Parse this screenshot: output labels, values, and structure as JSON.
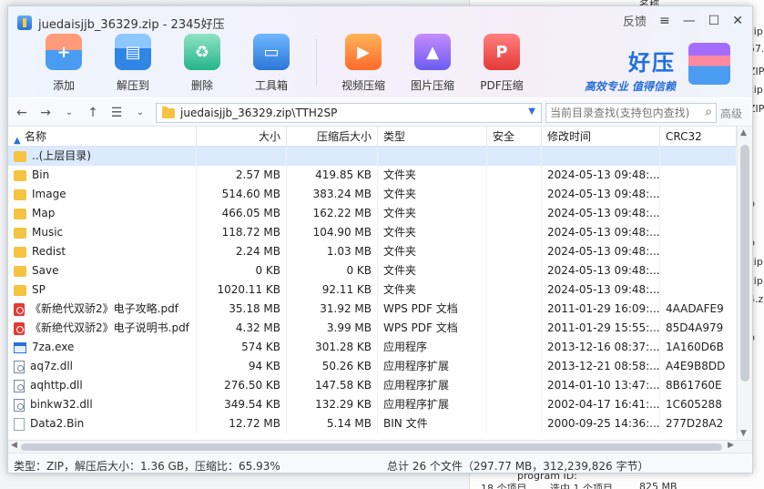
{
  "window": {
    "title": "juedaisjjb_36329.zip - 2345好压"
  },
  "win_controls": {
    "feedback": "反馈",
    "menu": "≡",
    "minimize": "—",
    "maximize": "☐",
    "close": "✕"
  },
  "toolbar": [
    {
      "label": "添加",
      "icon": "add-icon"
    },
    {
      "label": "解压到",
      "icon": "extract-icon"
    },
    {
      "label": "删除",
      "icon": "recycle-icon"
    },
    {
      "label": "工具箱",
      "icon": "toolbox-icon"
    },
    {
      "label": "视频压缩",
      "icon": "video-icon"
    },
    {
      "label": "图片压缩",
      "icon": "image-icon"
    },
    {
      "label": "PDF压缩",
      "icon": "pdf-icon"
    }
  ],
  "brand": {
    "name": "好压",
    "slogan": "高效专业  值得信赖"
  },
  "nav": {
    "path": "juedaisjjb_36329.zip\\TTH2SP",
    "search_placeholder": "当前目录查找(支持包内查找)",
    "advanced": "高级"
  },
  "columns": [
    "名称",
    "大小",
    "压缩后大小",
    "类型",
    "安全",
    "修改时间",
    "CRC32"
  ],
  "rows": [
    {
      "name": "..(上层目录)",
      "size": "",
      "packed": "",
      "type": "",
      "security": "",
      "modified": "",
      "crc": "",
      "kind": "folder",
      "selected": true
    },
    {
      "name": "Bin",
      "size": "2.57 MB",
      "packed": "419.85 KB",
      "type": "文件夹",
      "security": "",
      "modified": "2024-05-13 09:48:...",
      "crc": "",
      "kind": "folder"
    },
    {
      "name": "Image",
      "size": "514.60 MB",
      "packed": "383.24 MB",
      "type": "文件夹",
      "security": "",
      "modified": "2024-05-13 09:48:...",
      "crc": "",
      "kind": "folder"
    },
    {
      "name": "Map",
      "size": "466.05 MB",
      "packed": "162.22 MB",
      "type": "文件夹",
      "security": "",
      "modified": "2024-05-13 09:48:...",
      "crc": "",
      "kind": "folder"
    },
    {
      "name": "Music",
      "size": "118.72 MB",
      "packed": "104.90 MB",
      "type": "文件夹",
      "security": "",
      "modified": "2024-05-13 09:48:...",
      "crc": "",
      "kind": "folder"
    },
    {
      "name": "Redist",
      "size": "2.24 MB",
      "packed": "1.03 MB",
      "type": "文件夹",
      "security": "",
      "modified": "2024-05-13 09:48:...",
      "crc": "",
      "kind": "folder"
    },
    {
      "name": "Save",
      "size": "0 KB",
      "packed": "0 KB",
      "type": "文件夹",
      "security": "",
      "modified": "2024-05-13 09:48:...",
      "crc": "",
      "kind": "folder"
    },
    {
      "name": "SP",
      "size": "1020.11 KB",
      "packed": "92.11 KB",
      "type": "文件夹",
      "security": "",
      "modified": "2024-05-13 09:48:...",
      "crc": "",
      "kind": "folder"
    },
    {
      "name": "《新绝代双骄2》电子攻略.pdf",
      "size": "35.18 MB",
      "packed": "31.92 MB",
      "type": "WPS PDF 文档",
      "security": "",
      "modified": "2011-01-29 16:09:...",
      "crc": "4AADAFE9",
      "kind": "pdf"
    },
    {
      "name": "《新绝代双骄2》电子说明书.pdf",
      "size": "4.32 MB",
      "packed": "3.99 MB",
      "type": "WPS PDF 文档",
      "security": "",
      "modified": "2011-01-29 15:55:...",
      "crc": "85D4A979",
      "kind": "pdf"
    },
    {
      "name": "7za.exe",
      "size": "574 KB",
      "packed": "301.28 KB",
      "type": "应用程序",
      "security": "",
      "modified": "2013-12-16 08:37:...",
      "crc": "1A160D6B",
      "kind": "exe"
    },
    {
      "name": "aq7z.dll",
      "size": "94 KB",
      "packed": "50.26 KB",
      "type": "应用程序扩展",
      "security": "",
      "modified": "2013-12-21 08:58:...",
      "crc": "A4E9B8DD",
      "kind": "dll"
    },
    {
      "name": "aqhttp.dll",
      "size": "276.50 KB",
      "packed": "147.58 KB",
      "type": "应用程序扩展",
      "security": "",
      "modified": "2014-01-10 13:47:...",
      "crc": "8B61760E",
      "kind": "dll"
    },
    {
      "name": "binkw32.dll",
      "size": "349.54 KB",
      "packed": "132.29 KB",
      "type": "应用程序扩展",
      "security": "",
      "modified": "2002-04-17 16:41:...",
      "crc": "1C605288",
      "kind": "dll"
    },
    {
      "name": "Data2.Bin",
      "size": "12.72 MB",
      "packed": "5.14 MB",
      "type": "BIN 文件",
      "security": "",
      "modified": "2000-09-25 14:36:...",
      "crc": "277D28A2",
      "kind": "bin"
    }
  ],
  "status": {
    "left": "类型：ZIP，解压后大小：1.36 GB，压缩比：65.93%",
    "right": "总计 26 个文件（297.77 MB，312,239,826 字节）"
  },
  "background": {
    "fragments": [
      "名称",
      "zip",
      "57.",
      "ZIP",
      "zip",
      "ZIP",
      "p",
      "p",
      "zip",
      "zip",
      "4.z",
      "p",
      "program ID:",
      "18 个项目",
      "选中 1 个项目",
      "825 MB"
    ]
  }
}
